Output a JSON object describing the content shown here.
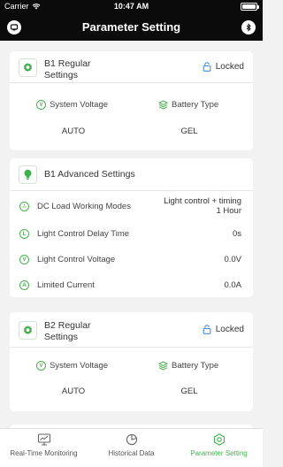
{
  "status_bar": {
    "carrier": "Carrier",
    "time": "10:47 AM"
  },
  "nav": {
    "title": "Parameter Setting",
    "left_icon": "device-icon",
    "right_icon": "bluetooth-icon"
  },
  "colors": {
    "accent": "#43b04f",
    "header_bg": "#0b0b0b",
    "page_bg": "#f2f2f2"
  },
  "b1_regular": {
    "title": "B1 Regular\nSettings",
    "lock_label": "Locked",
    "voltage_label": "System Voltage",
    "voltage_value": "AUTO",
    "battery_label": "Battery Type",
    "battery_value": "GEL"
  },
  "b1_advanced": {
    "title": "B1 Advanced Settings",
    "rows": [
      {
        "icon": "load-mode-icon",
        "label": "DC Load Working Modes",
        "value": "Light control + timing\n1 Hour"
      },
      {
        "icon": "delay-icon",
        "label": "Light Control Delay Time",
        "value": "0s"
      },
      {
        "icon": "voltage-icon",
        "label": "Light Control Voltage",
        "value": "0.0V"
      },
      {
        "icon": "current-icon",
        "label": "Limited Current",
        "value": "0.0A"
      }
    ]
  },
  "b2_regular": {
    "title": "B2 Regular\nSettings",
    "lock_label": "Locked",
    "voltage_label": "System Voltage",
    "voltage_value": "AUTO",
    "battery_label": "Battery Type",
    "battery_value": "GEL"
  },
  "tabs": [
    {
      "label": "Real-Time Monitoring",
      "icon": "monitor-icon",
      "active": false
    },
    {
      "label": "Historical Data",
      "icon": "pie-chart-icon",
      "active": false
    },
    {
      "label": "Parameter Setting",
      "icon": "settings-icon",
      "active": true
    }
  ]
}
